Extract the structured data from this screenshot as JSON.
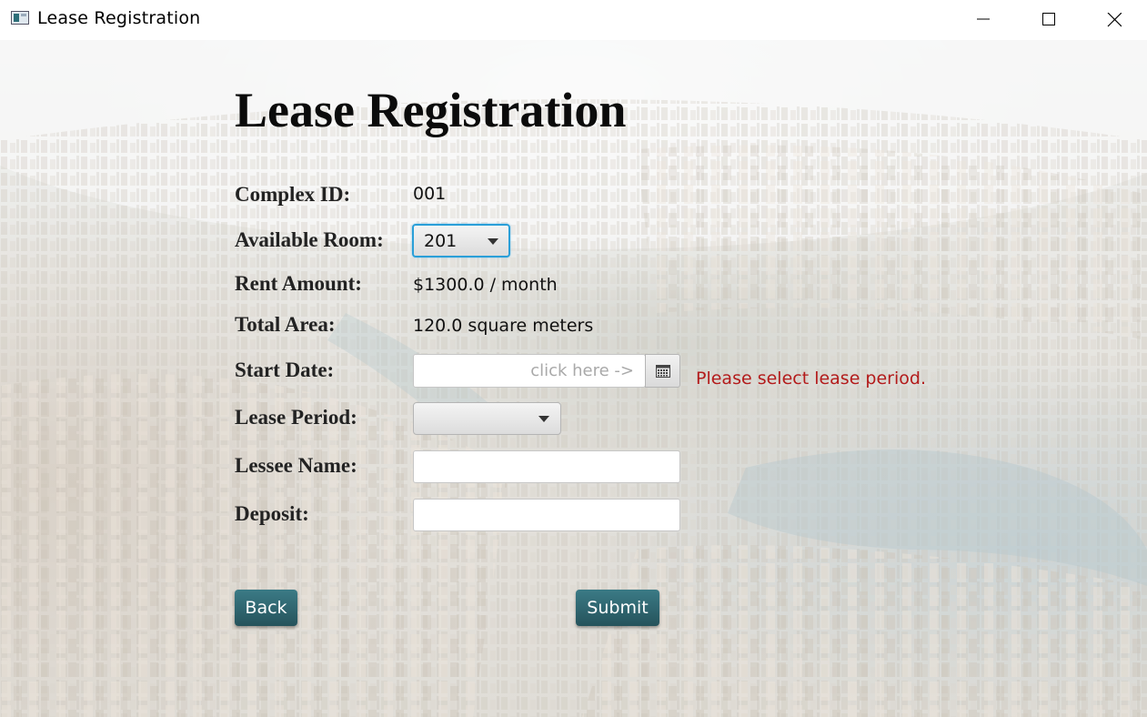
{
  "window": {
    "title": "Lease Registration",
    "icon": "app-window-icon",
    "controls": {
      "minimize": "minimize-icon",
      "maximize": "maximize-icon",
      "close": "close-icon"
    }
  },
  "form": {
    "heading": "Lease Registration",
    "complex_id": {
      "label": "Complex ID:",
      "value": "001"
    },
    "available_room": {
      "label": "Available Room:",
      "selected": "201"
    },
    "rent_amount": {
      "label": "Rent Amount:",
      "value": "$1300.0 / month"
    },
    "total_area": {
      "label": "Total Area:",
      "value": "120.0 square meters"
    },
    "start_date": {
      "label": "Start Date:",
      "value": "",
      "placeholder": "click here ->",
      "icon": "calendar-icon"
    },
    "lease_period": {
      "label": "Lease Period:",
      "selected": "",
      "error": "Please select lease period."
    },
    "lessee_name": {
      "label": "Lessee Name:",
      "value": ""
    },
    "deposit": {
      "label": "Deposit:",
      "value": ""
    }
  },
  "actions": {
    "back": "Back",
    "submit": "Submit"
  },
  "colors": {
    "button": "#2f6670",
    "focus_border": "#2a9fd8",
    "error": "#b31b1b"
  }
}
